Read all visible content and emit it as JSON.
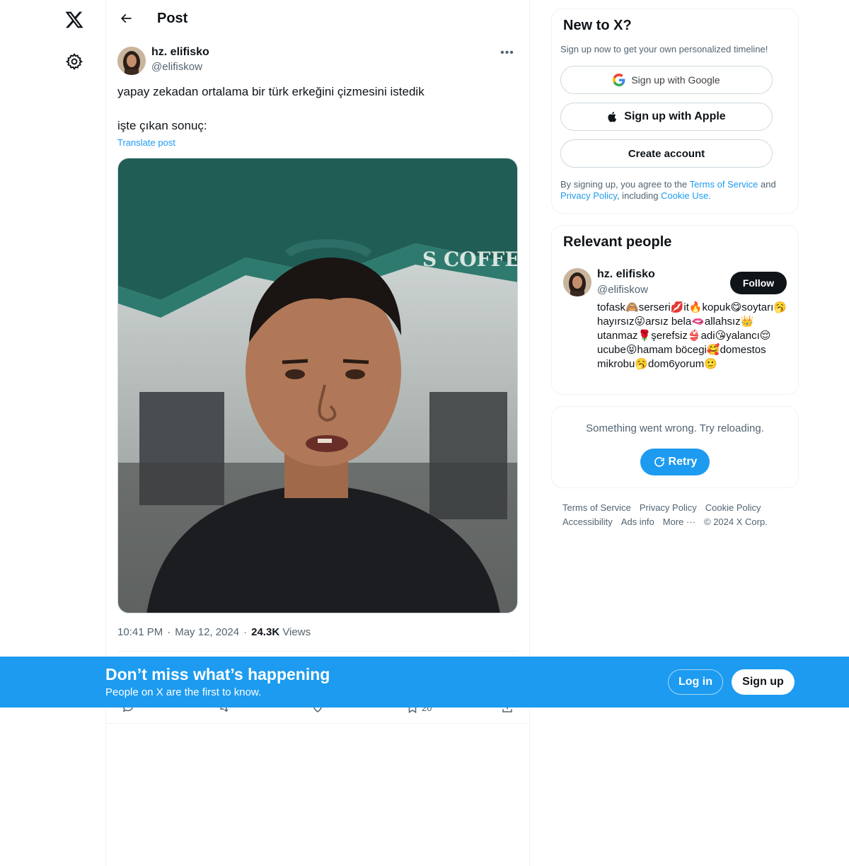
{
  "left_nav": {
    "logo_icon": "x-logo-icon",
    "settings_icon": "gear-icon"
  },
  "header": {
    "title": "Post"
  },
  "post": {
    "author_name": "hz. elifisko",
    "author_handle": "@elifiskow",
    "text": "yapay zekadan ortalama bir türk erkeğini çizmesini istedik\n\nişte çıkan sonuç:",
    "translate_label": "Translate post",
    "photo_sign_text": "S COFFEE",
    "time": "10:41 PM",
    "date": "May 12, 2024",
    "views_count": "24.3K",
    "views_label": "Views",
    "bookmark_count": "20"
  },
  "sidebar": {
    "signup_card": {
      "title": "New to X?",
      "subtitle": "Sign up now to get your own personalized timeline!",
      "google_label": "Sign up with Google",
      "apple_label": "Sign up with Apple",
      "create_label": "Create account",
      "legal_prefix": "By signing up, you agree to the ",
      "terms_link": "Terms of Service",
      "legal_and": " and ",
      "privacy_link": "Privacy Policy",
      "legal_including": ", including ",
      "cookie_link": "Cookie Use."
    },
    "relevant_people": {
      "title": "Relevant people",
      "name": "hz. elifisko",
      "handle": "@elifiskow",
      "follow_label": "Follow",
      "bio": "tofask🙈serseri💋it🔥kopuk😋soytarı🥱hayırsız😜arsız bela🫦allahsız👑utanmaz🌹şerefsiz👙adi😘yalancı😌ucube😝hamam böcegi🥰domestos mikrobu🥱dom6yorum🙂"
    },
    "error_card": {
      "message": "Something went wrong. Try reloading.",
      "retry_label": "Retry"
    },
    "footer": {
      "terms": "Terms of Service",
      "privacy": "Privacy Policy",
      "cookie": "Cookie Policy",
      "accessibility": "Accessibility",
      "ads": "Ads info",
      "more": "More ···",
      "copyright": "© 2024 X Corp."
    }
  },
  "banner": {
    "title": "Don’t miss what’s happening",
    "subtitle": "People on X are the first to know.",
    "login_label": "Log in",
    "signup_label": "Sign up"
  },
  "colors": {
    "accent": "#1d9bf0",
    "text": "#0f1419",
    "muted": "#536471",
    "border": "#eff3f4"
  }
}
